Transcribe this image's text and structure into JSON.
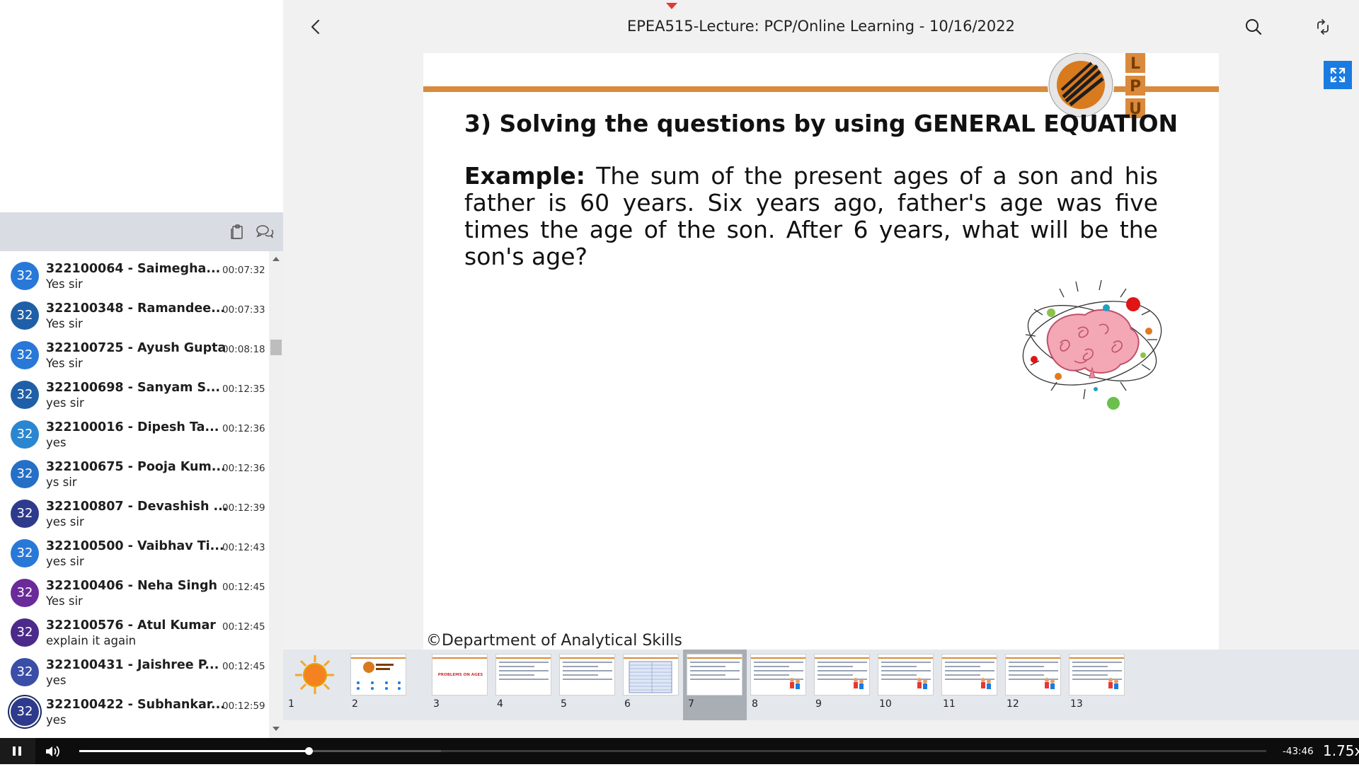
{
  "header": {
    "title": "EPEA515-Lecture: PCP/Online Learning - 10/16/2022"
  },
  "slide": {
    "title": "3) Solving the questions by using GENERAL EQUATION",
    "example_label": "Example:",
    "example_text": " The sum of the present ages of a son and his father is 60 years. Six years ago, father's age was five times the age of the son. After 6 years, what will be the son's age?",
    "footer": "©Department of Analytical Skills",
    "logo_letters": [
      "L",
      "P",
      "U"
    ]
  },
  "chat": {
    "messages": [
      {
        "avatar": "32",
        "name": "322100064 - Saimegha...",
        "time": "00:07:32",
        "text": "Yes sir",
        "color": "#2878d8"
      },
      {
        "avatar": "32",
        "name": "322100348 - Ramandee...",
        "time": "00:07:33",
        "text": "Yes sir",
        "color": "#1f5fa8"
      },
      {
        "avatar": "32",
        "name": "322100725 - Ayush Gupta",
        "time": "00:08:18",
        "text": "Yes sir",
        "color": "#2878d8"
      },
      {
        "avatar": "32",
        "name": "322100698 - Sanyam S...",
        "time": "00:12:35",
        "text": "yes sir",
        "color": "#1f5fa8"
      },
      {
        "avatar": "32",
        "name": "322100016 - Dipesh Ta...",
        "time": "00:12:36",
        "text": "yes",
        "color": "#2a86d0"
      },
      {
        "avatar": "32",
        "name": "322100675 - Pooja Kum...",
        "time": "00:12:36",
        "text": "ys sir",
        "color": "#2570c6"
      },
      {
        "avatar": "32",
        "name": "322100807 - Devashish ...",
        "time": "00:12:39",
        "text": "yes sir",
        "color": "#2e3a8c"
      },
      {
        "avatar": "32",
        "name": "322100500 - Vaibhav Ti...",
        "time": "00:12:43",
        "text": "yes sir",
        "color": "#2878d8"
      },
      {
        "avatar": "32",
        "name": "322100406 - Neha Singh",
        "time": "00:12:45",
        "text": "Yes sir",
        "color": "#6a2a9a"
      },
      {
        "avatar": "32",
        "name": "322100576 - Atul Kumar",
        "time": "00:12:45",
        "text": "explain it again",
        "color": "#4b2a8a"
      },
      {
        "avatar": "32",
        "name": "322100431 - Jaishree P...",
        "time": "00:12:45",
        "text": "yes",
        "color": "#3a4ea8"
      },
      {
        "avatar": "32",
        "name": "322100422 - Subhankar...",
        "time": "00:12:59",
        "text": "yes",
        "color": "#2e3a8c"
      }
    ]
  },
  "thumbnails": {
    "active": "7",
    "items": [
      {
        "num": "1",
        "kind": "sun"
      },
      {
        "num": "2",
        "kind": "title"
      },
      {
        "num": "3",
        "kind": "ages",
        "label": "PROBLEMS ON AGES"
      },
      {
        "num": "4",
        "kind": "text"
      },
      {
        "num": "5",
        "kind": "text"
      },
      {
        "num": "6",
        "kind": "table"
      },
      {
        "num": "7",
        "kind": "text"
      },
      {
        "num": "8",
        "kind": "people"
      },
      {
        "num": "9",
        "kind": "people"
      },
      {
        "num": "10",
        "kind": "people"
      },
      {
        "num": "11",
        "kind": "people"
      },
      {
        "num": "12",
        "kind": "people"
      },
      {
        "num": "13",
        "kind": "people"
      }
    ]
  },
  "player": {
    "state": "playing",
    "time_remaining": "-43:46",
    "speed": "1.75x",
    "progress_fraction": 0.193,
    "buffered_fraction": 0.305
  },
  "colors": {
    "accent": "#1a7be0",
    "slide_rule": "#d98a3d",
    "marker": "#e53935"
  },
  "icons": [
    "back-icon",
    "search-icon",
    "rotate-icon",
    "fullscreen-icon",
    "notes-icon",
    "chat-icon",
    "pause-icon",
    "volume-icon"
  ]
}
